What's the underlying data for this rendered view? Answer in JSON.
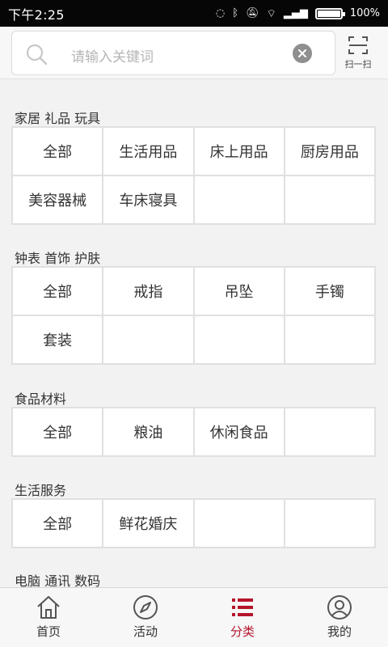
{
  "status_bar": {
    "time": "下午2:25",
    "battery": "100%"
  },
  "search": {
    "placeholder": "请输入关键词",
    "scan_label": "扫一扫"
  },
  "sections": [
    {
      "title": "家居 礼品 玩具",
      "items": [
        "全部",
        "生活用品",
        "床上用品",
        "厨房用品",
        "美容器械",
        "车床寝具",
        "",
        ""
      ]
    },
    {
      "title": "钟表 首饰 护肤",
      "items": [
        "全部",
        "戒指",
        "吊坠",
        "手镯",
        "套装",
        "",
        "",
        ""
      ]
    },
    {
      "title": "食品材料",
      "items": [
        "全部",
        "粮油",
        "休闲食品",
        ""
      ]
    },
    {
      "title": "生活服务",
      "items": [
        "全部",
        "鲜花婚庆",
        "",
        ""
      ]
    },
    {
      "title": "电脑 通讯 数码",
      "items": []
    }
  ],
  "tabbar": {
    "items": [
      {
        "label": "首页",
        "icon": "home-icon"
      },
      {
        "label": "活动",
        "icon": "compass-icon"
      },
      {
        "label": "分类",
        "icon": "list-icon"
      },
      {
        "label": "我的",
        "icon": "user-icon"
      }
    ],
    "active_index": 2
  },
  "colors": {
    "accent": "#b5162b",
    "background": "#f2f2f2",
    "grid_line": "#e0e0e0"
  }
}
